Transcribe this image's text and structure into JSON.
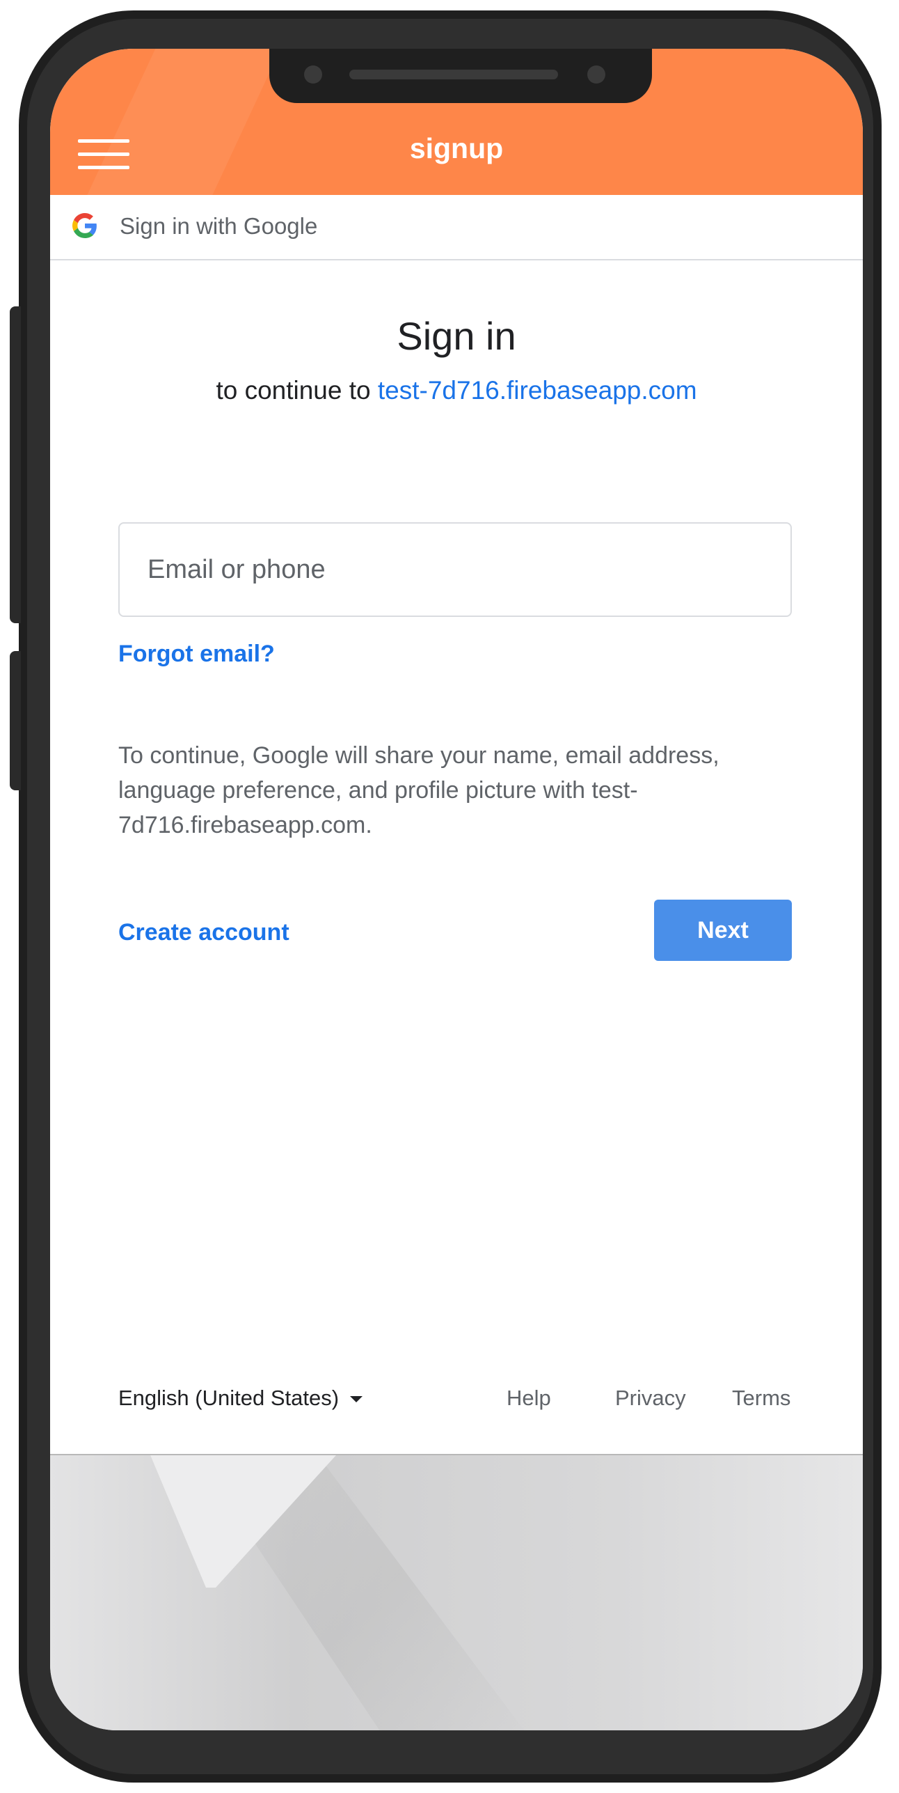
{
  "header": {
    "title": "signup",
    "background_color": "#fe8649"
  },
  "google_bar": {
    "icon": "google-g-icon",
    "label": "Sign in with Google"
  },
  "signin": {
    "title": "Sign in",
    "continue_prefix": "to continue to",
    "app_domain": "test-7d716.firebaseapp.com",
    "email_placeholder": "Email or phone",
    "email_value": "",
    "forgot_email": "Forgot email?",
    "share_notice": "To continue, Google will share your name, email address, language preference, and profile picture with test-7d716.firebaseapp.com.",
    "create_account": "Create account",
    "next": "Next",
    "accent_color": "#1a73e8",
    "button_color": "#4a8fe9"
  },
  "footer": {
    "language": "English (United States)",
    "help": "Help",
    "privacy": "Privacy",
    "terms": "Terms"
  }
}
